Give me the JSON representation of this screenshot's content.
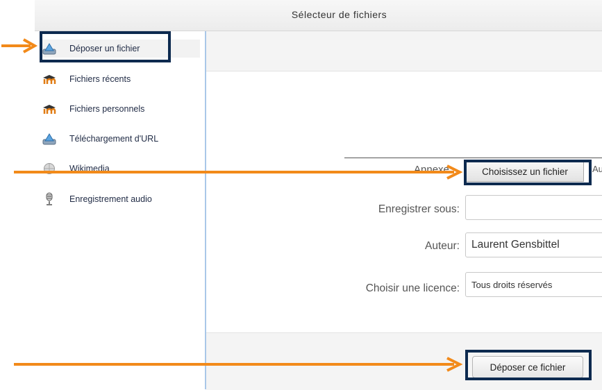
{
  "window": {
    "title": "Sélecteur de fichiers"
  },
  "sidebar": {
    "items": [
      {
        "label": "Déposer un fichier",
        "icon": "upload-icon"
      },
      {
        "label": "Fichiers récents",
        "icon": "moodle-icon"
      },
      {
        "label": "Fichiers personnels",
        "icon": "moodle-icon"
      },
      {
        "label": "Téléchargement d'URL",
        "icon": "url-download-icon"
      },
      {
        "label": "Wikimedia",
        "icon": "wikimedia-icon"
      },
      {
        "label": "Enregistrement audio",
        "icon": "microphone-icon"
      }
    ]
  },
  "form": {
    "attachment_label": "Annexe",
    "choose_file_label": "Choisissez un fichier",
    "after_button_text": "Au",
    "save_as_label": "Enregistrer sous:",
    "save_as_value": "",
    "author_label": "Auteur:",
    "author_value": "Laurent Gensbittel",
    "license_label": "Choisir une licence:",
    "license_value": "Tous droits réservés"
  },
  "footer": {
    "upload_label": "Déposer ce fichier"
  },
  "colors": {
    "arrow": "#f28a1a",
    "highlight": "#0d2a4f",
    "sidebar_border": "#a9c7e8"
  }
}
